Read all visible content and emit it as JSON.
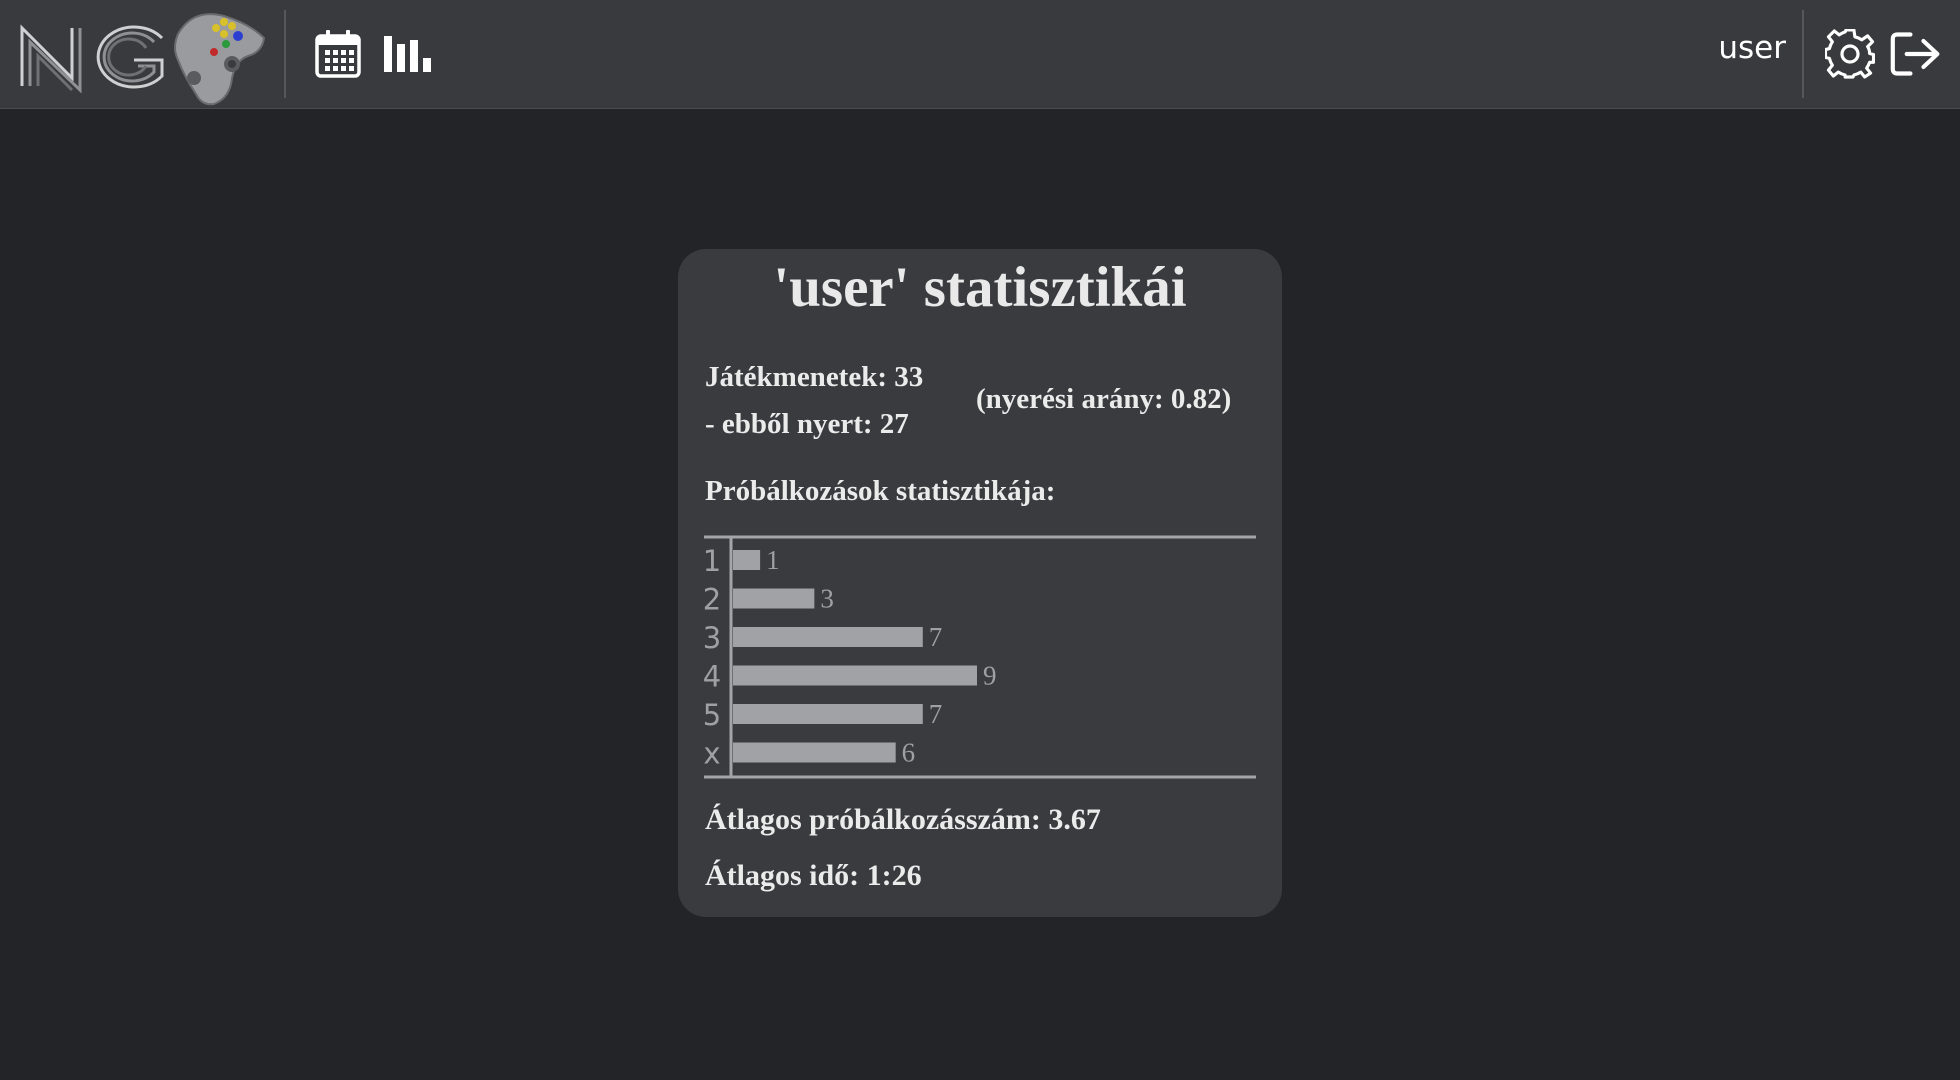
{
  "header": {
    "username": "user",
    "nav": {
      "calendar_icon": "calendar-icon",
      "stats_icon": "bar-chart-icon"
    },
    "actions": {
      "settings_icon": "gear-icon",
      "logout_icon": "logout-icon"
    },
    "logo_text": "NG"
  },
  "stats": {
    "title": "'user' statisztikái",
    "games_played": "Játékmenetek: 33",
    "games_won": "- ebből nyert: 27",
    "win_rate": "(nyerési arány: 0.82)",
    "attempts_heading": "Próbálkozások statisztikája:",
    "average_attempts": "Átlagos próbálkozásszám: 3.67",
    "average_time": "Átlagos idő: 1:26"
  },
  "chart_data": {
    "type": "bar",
    "orientation": "horizontal",
    "categories": [
      "1",
      "2",
      "3",
      "4",
      "5",
      "x"
    ],
    "values": [
      1,
      3,
      7,
      9,
      7,
      6
    ],
    "title": "",
    "xlabel": "",
    "ylabel": "",
    "xlim": [
      0,
      9
    ],
    "grid": false,
    "bar_color": "#a1a2a6",
    "label_color": "#9fa0a4"
  },
  "colors": {
    "background": "#232427",
    "topbar": "#393a3d",
    "card": "#3a3b3e",
    "text": "#ffffff"
  }
}
